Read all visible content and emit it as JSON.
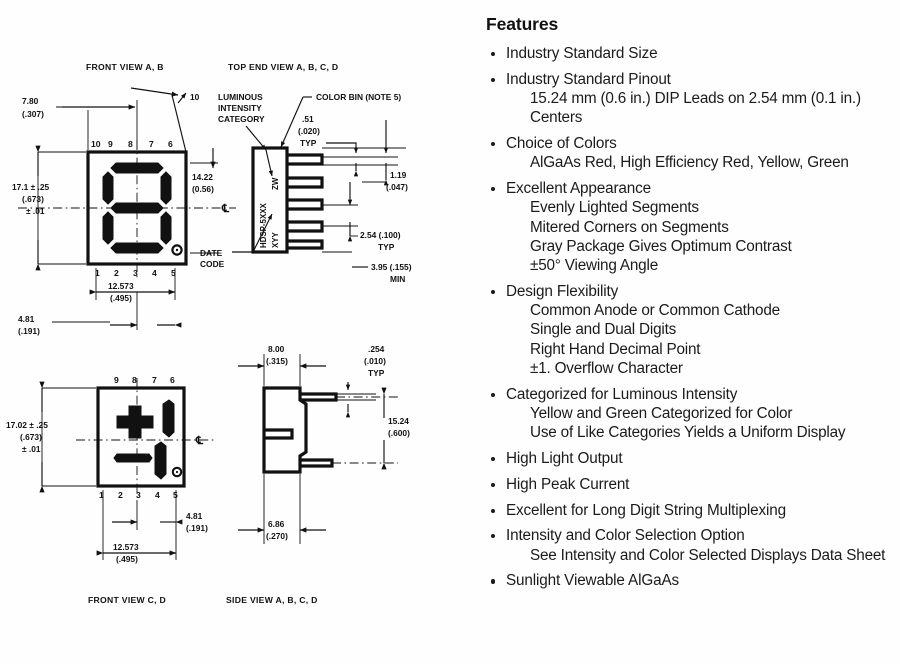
{
  "page": {
    "background": "#fefefe",
    "ink": "#111111"
  },
  "features": {
    "heading": "Features",
    "items": [
      {
        "label": "Industry Standard Size",
        "sub": []
      },
      {
        "label": "Industry Standard Pinout",
        "sub": [
          "15.24 mm (0.6 in.) DIP Leads on 2.54 mm (0.1 in.) Centers"
        ]
      },
      {
        "label": "Choice of Colors",
        "sub": [
          "AlGaAs Red, High Efficiency Red, Yellow, Green"
        ]
      },
      {
        "label": "Excellent Appearance",
        "sub": [
          "Evenly Lighted Segments",
          "Mitered Corners on Segments",
          "Gray Package Gives Optimum Contrast",
          "±50° Viewing Angle"
        ]
      },
      {
        "label": "Design Flexibility",
        "sub": [
          "Common Anode or Common Cathode",
          "Single and Dual Digits",
          "Right Hand Decimal Point",
          "±1. Overflow Character"
        ]
      },
      {
        "label": "Categorized for Luminous Intensity",
        "sub": [
          "Yellow and Green Categorized for Color",
          "Use of Like Categories Yields a Uniform Display"
        ]
      },
      {
        "label": "High Light Output",
        "sub": []
      },
      {
        "label": "High Peak Current",
        "sub": []
      },
      {
        "label": "Excellent for Long Digit String Multiplexing",
        "sub": []
      },
      {
        "label": "Intensity and Color Selection Option",
        "sub": [
          "See Intensity and Color Selected Displays Data Sheet"
        ]
      },
      {
        "label": "Sunlight Viewable AlGaAs",
        "sub": []
      }
    ]
  },
  "drawing": {
    "captions": {
      "front_view_ab": "FRONT VIEW A, B",
      "top_end_view": "TOP END VIEW A, B, C, D",
      "front_view_cd": "FRONT VIEW C, D",
      "side_view": "SIDE VIEW A, B, C, D"
    },
    "callouts": {
      "luminous": [
        "LUMINOUS",
        "INTENSITY",
        "CATEGORY"
      ],
      "color_bin": "COLOR BIN (NOTE 5)",
      "date_code": [
        "DATE",
        "CODE"
      ],
      "part_marking": "HDSP-5XXX",
      "bin_marking": "XYY",
      "cat_marking": "ZW"
    },
    "dimensions": {
      "width_780": [
        "7.80",
        "(.307)"
      ],
      "height_171": [
        "17.1 ± .25",
        "(.673)",
        "± .01"
      ],
      "digit_1422": [
        "14.22",
        "(0.56)"
      ],
      "lead_span_12573": [
        "12.573",
        "(.495)"
      ],
      "edge_481": [
        "4.81",
        "(.191)"
      ],
      "lead_thick_51": [
        ".51",
        "(.020)",
        "TYP"
      ],
      "lead_width_119": [
        "1.19",
        "(.047)"
      ],
      "pitch_254": [
        "2.54 (.100)",
        "TYP"
      ],
      "min_395": [
        "3.95 (.155)",
        "MIN"
      ],
      "height_1702": [
        "17.02 ± .25",
        "(.673)",
        "± .01"
      ],
      "depth_800": [
        "8.00",
        "(.315)"
      ],
      "lead_254": [
        ".254",
        "(.010)",
        "TYP"
      ],
      "lead_len_1524": [
        "15.24",
        "(.600)"
      ],
      "body_686": [
        "6.86",
        "(.270)"
      ]
    },
    "pin_numbers_top": [
      "10",
      "9",
      "8",
      "7",
      "6"
    ],
    "pin_numbers_bottom": [
      "1",
      "2",
      "3",
      "4",
      "5"
    ],
    "pin_numbers_top_cd": [
      "9",
      "8",
      "7",
      "6"
    ],
    "pin_numbers_bottom_cd": [
      "1",
      "2",
      "3",
      "4",
      "5"
    ],
    "leader_10": "10",
    "centerline_symbol": "℄"
  }
}
